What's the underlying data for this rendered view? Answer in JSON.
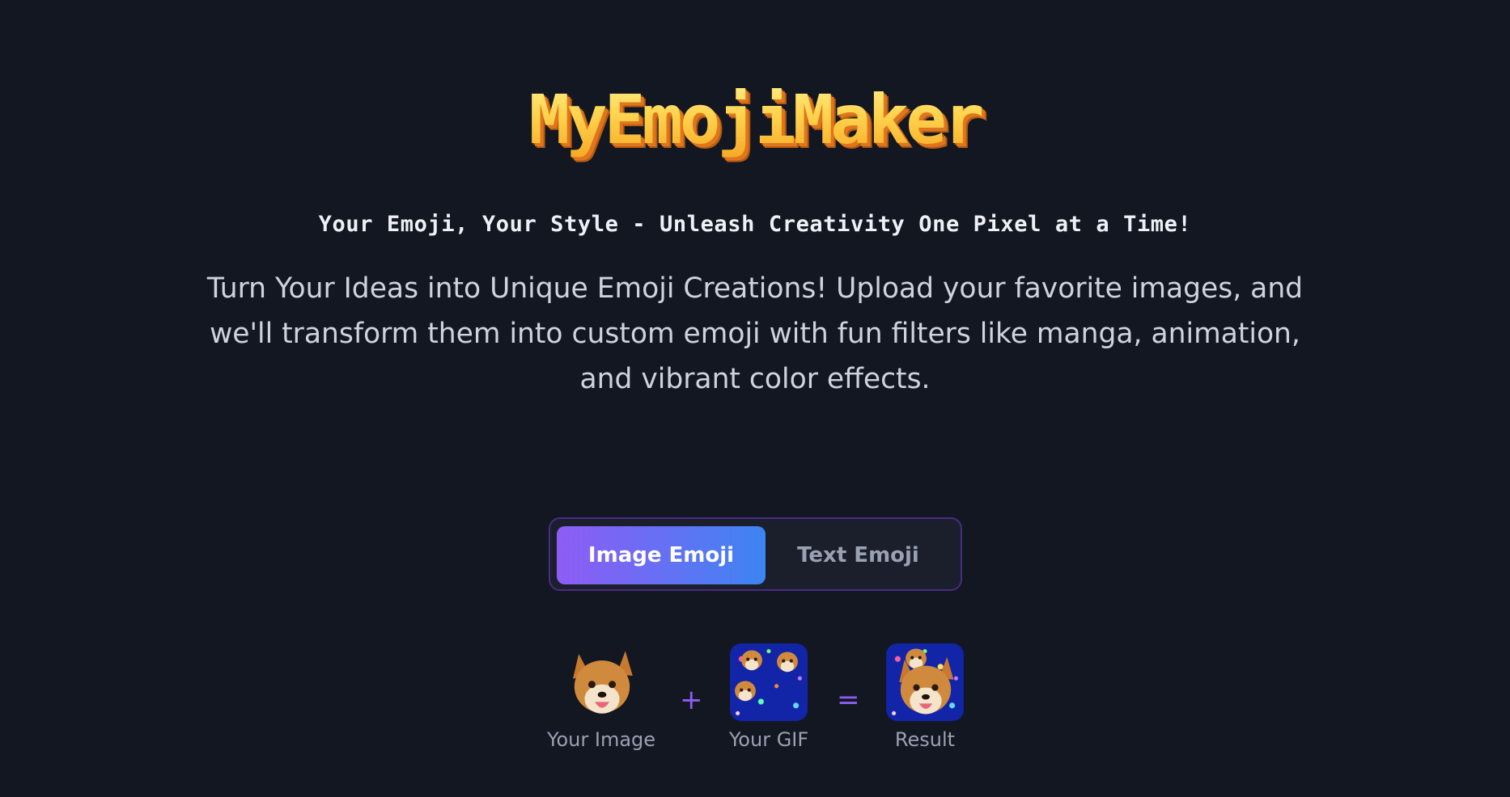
{
  "header": {
    "logo_text": "MyEmojiMaker",
    "tagline": "Your Emoji, Your Style - Unleash Creativity One Pixel at a Time!",
    "description": "Turn Your Ideas into Unique Emoji Creations! Upload your favorite images, and we'll transform them into custom emoji with fun filters like manga, animation, and vibrant color effects."
  },
  "mode_toggle": {
    "options": [
      {
        "label": "Image Emoji",
        "active": true
      },
      {
        "label": "Text Emoji",
        "active": false
      }
    ]
  },
  "formula": {
    "operators": [
      "+",
      "="
    ],
    "items": [
      {
        "caption": "Your Image",
        "icon": "shiba-dog-image"
      },
      {
        "caption": "Your GIF",
        "icon": "starfield-gif-image"
      },
      {
        "caption": "Result",
        "icon": "result-emoji-image"
      }
    ]
  },
  "colors": {
    "background": "#131722",
    "accent_purple": "#8f5cf5",
    "accent_blue": "#3d84f2",
    "logo_yellow": "#ffd34e",
    "logo_orange": "#f5a623",
    "gif_blue": "#1224a8"
  }
}
